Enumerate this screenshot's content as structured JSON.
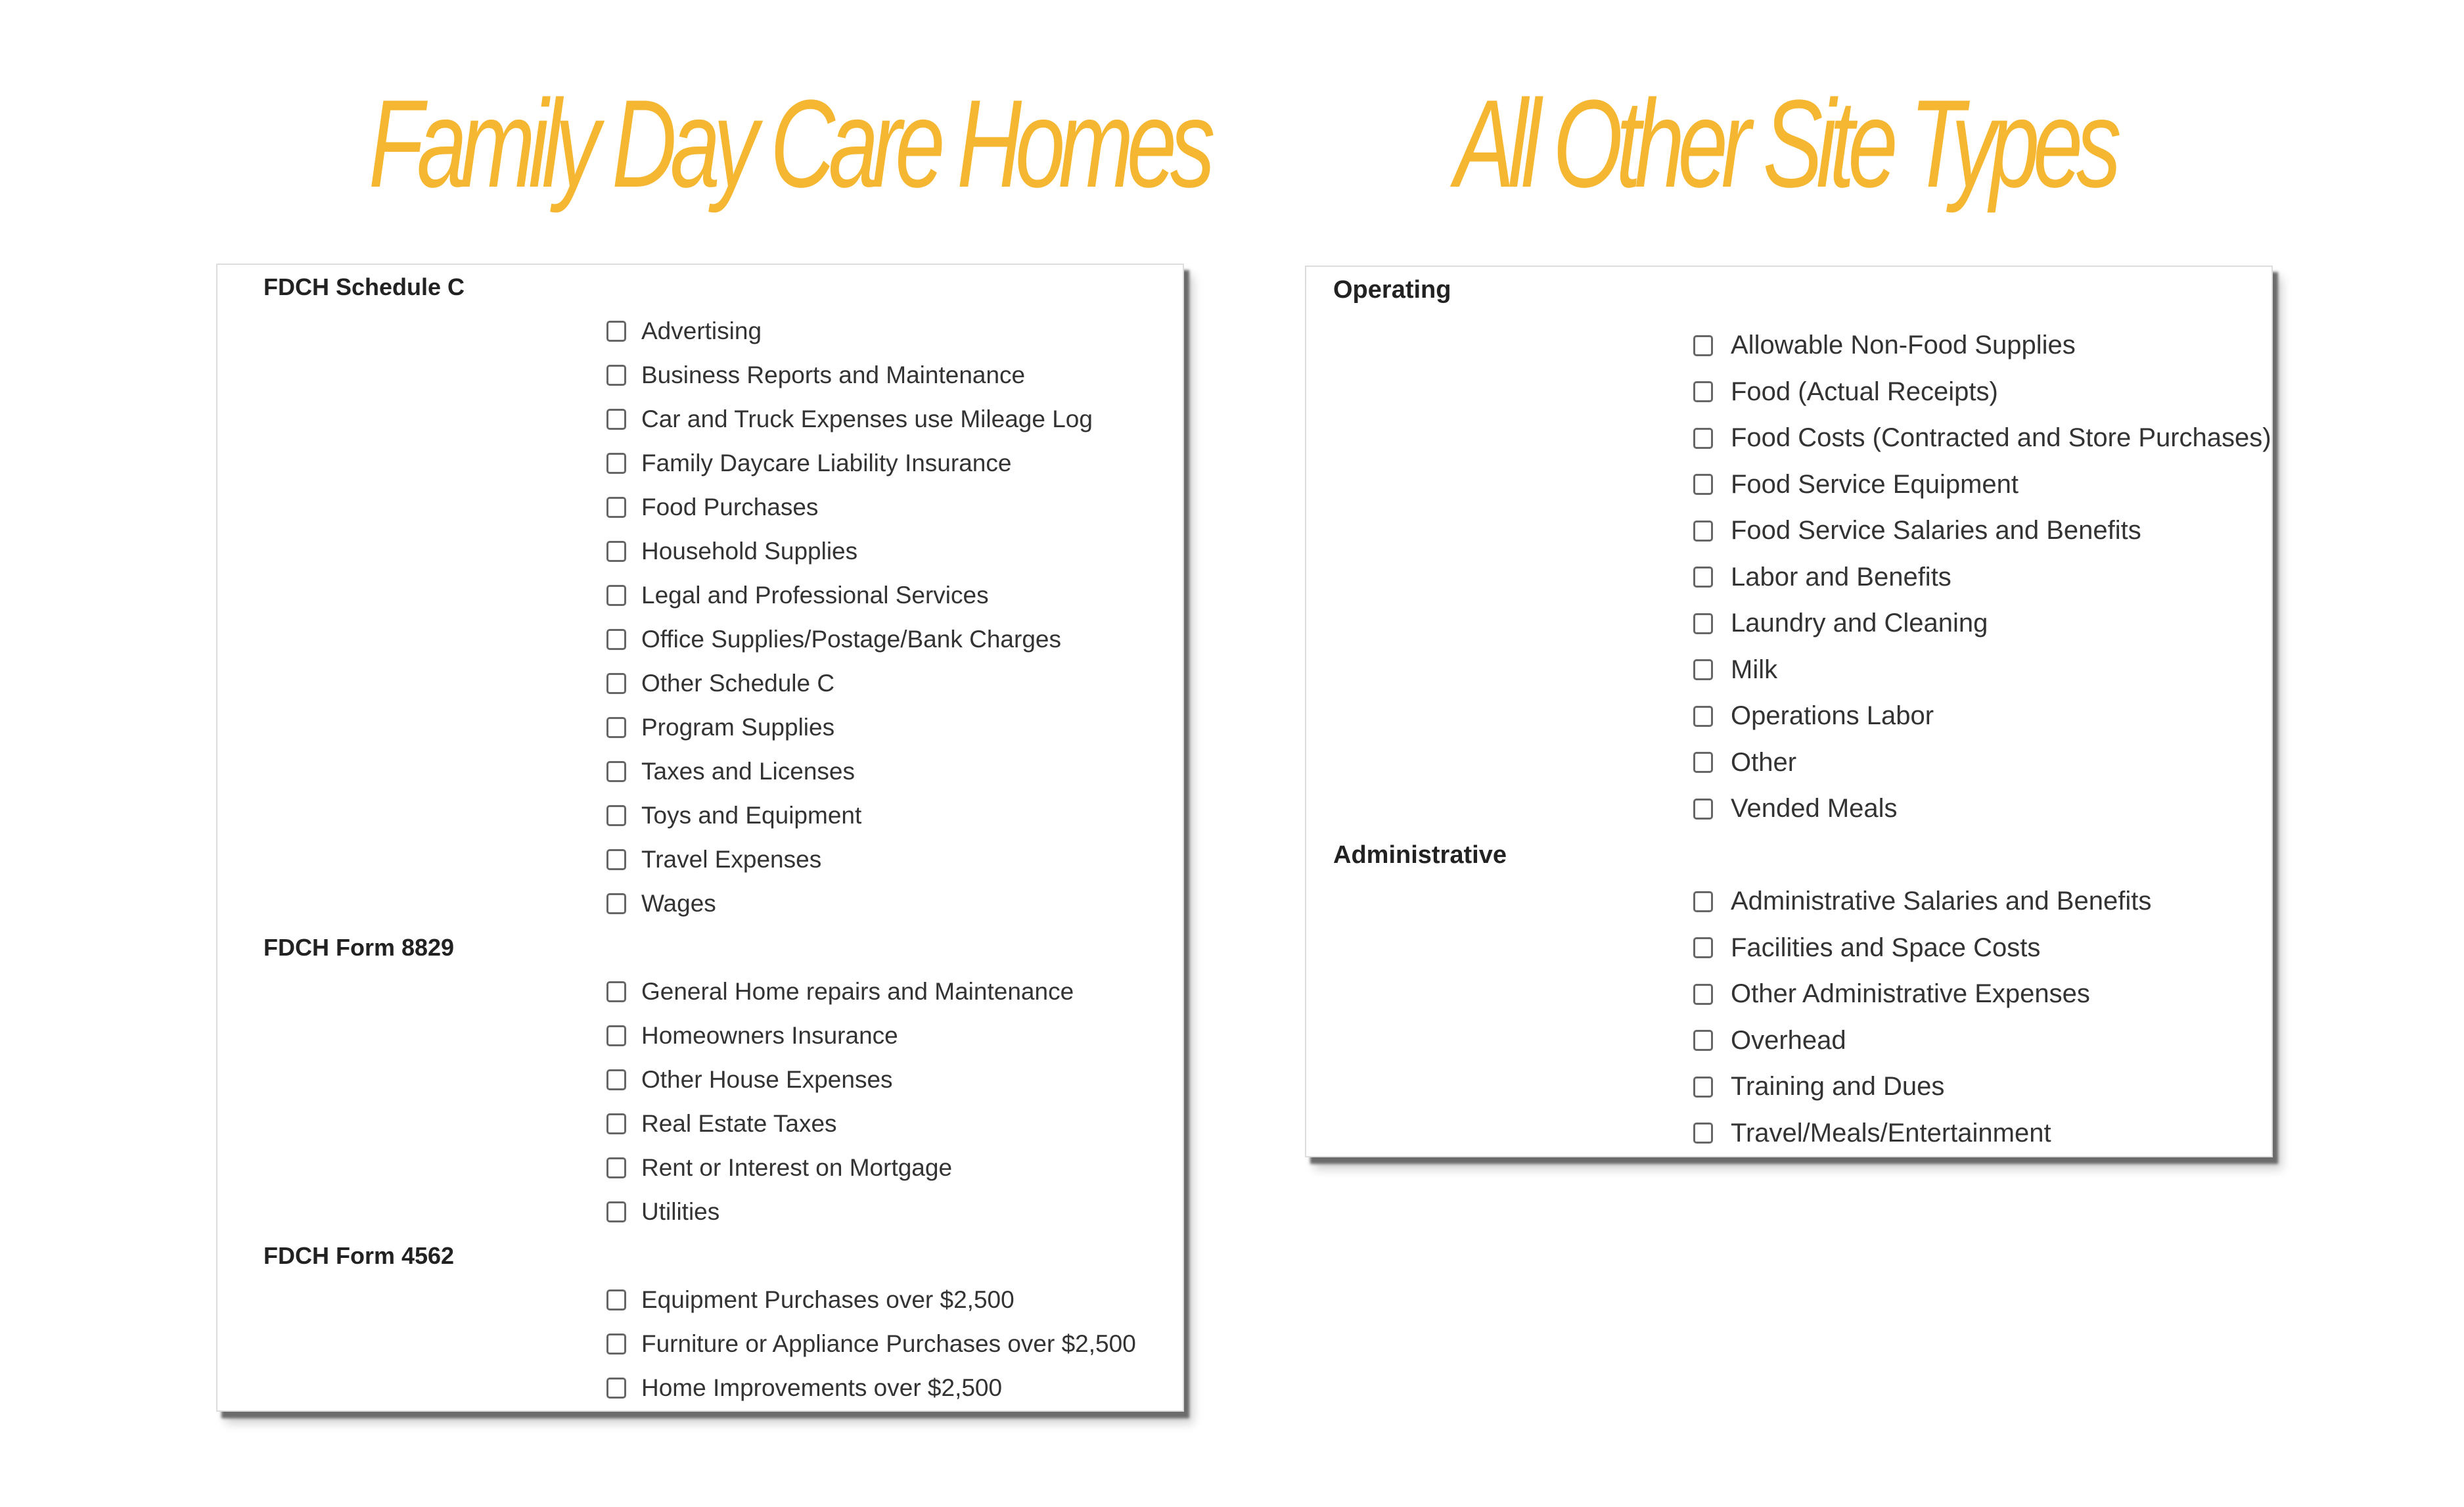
{
  "titles": {
    "left": "Family Day Care Homes",
    "right": "All Other Site Types"
  },
  "colors": {
    "title": "#f5b731"
  },
  "left_panel": {
    "sections": [
      {
        "heading": "FDCH Schedule C",
        "items": [
          "Advertising",
          "Business Reports and Maintenance",
          "Car and Truck Expenses use Mileage Log",
          "Family Daycare Liability Insurance",
          "Food Purchases",
          "Household Supplies",
          "Legal and Professional Services",
          "Office Supplies/Postage/Bank Charges",
          "Other Schedule C",
          "Program Supplies",
          "Taxes and Licenses",
          "Toys and Equipment",
          "Travel Expenses",
          "Wages"
        ]
      },
      {
        "heading": "FDCH Form 8829",
        "items": [
          "General Home repairs and Maintenance",
          "Homeowners Insurance",
          "Other House Expenses",
          "Real Estate Taxes",
          "Rent or Interest on Mortgage",
          "Utilities"
        ]
      },
      {
        "heading": "FDCH Form 4562",
        "items": [
          "Equipment Purchases over $2,500",
          "Furniture or Appliance Purchases over $2,500",
          "Home Improvements over $2,500"
        ]
      }
    ]
  },
  "right_panel": {
    "sections": [
      {
        "heading": "Operating",
        "items": [
          "Allowable Non-Food Supplies",
          "Food (Actual Receipts)",
          "Food Costs (Contracted and Store Purchases)",
          "Food Service Equipment",
          "Food Service Salaries and Benefits",
          "Labor and Benefits",
          "Laundry and Cleaning",
          "Milk",
          "Operations Labor",
          "Other",
          "Vended Meals"
        ]
      },
      {
        "heading": "Administrative",
        "items": [
          "Administrative Salaries and Benefits",
          "Facilities and Space Costs",
          "Other Administrative Expenses",
          "Overhead",
          "Training and Dues",
          "Travel/Meals/Entertainment"
        ]
      }
    ]
  }
}
